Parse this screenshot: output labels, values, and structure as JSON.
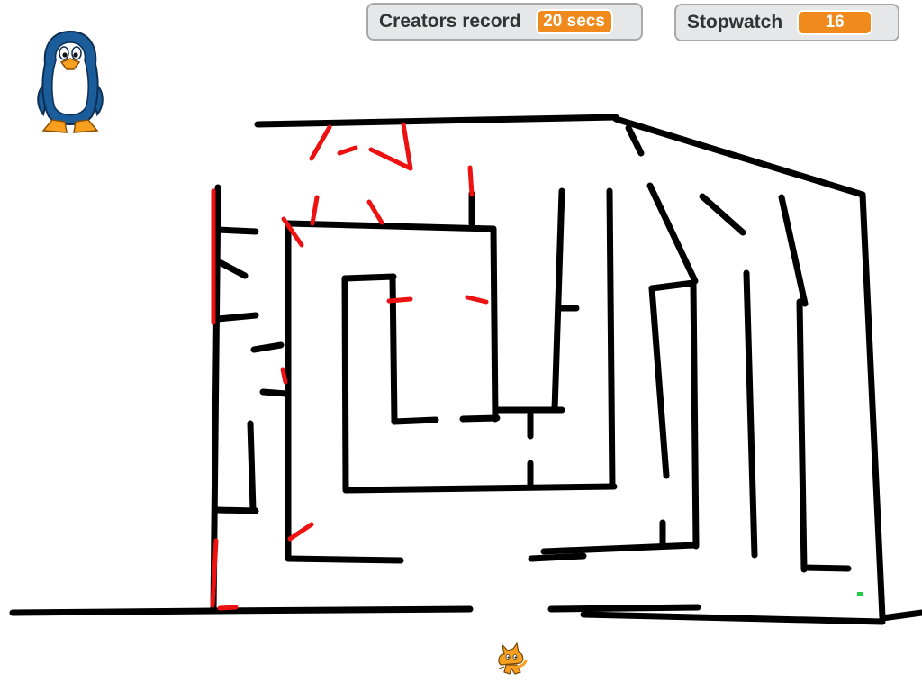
{
  "monitors": {
    "creators_record": {
      "label": "Creators record",
      "value": "20 secs"
    },
    "stopwatch": {
      "label": "Stopwatch",
      "value": "16"
    }
  },
  "colors": {
    "maze_wall": "#000000",
    "trail": "#ee1111",
    "monitor_value_bg": "#f08a1c",
    "monitor_bg": "#e6e7e8",
    "goal_marker": "#22cc44"
  },
  "sprites": {
    "player": "cat-sprite",
    "character": "penguin-sprite"
  }
}
